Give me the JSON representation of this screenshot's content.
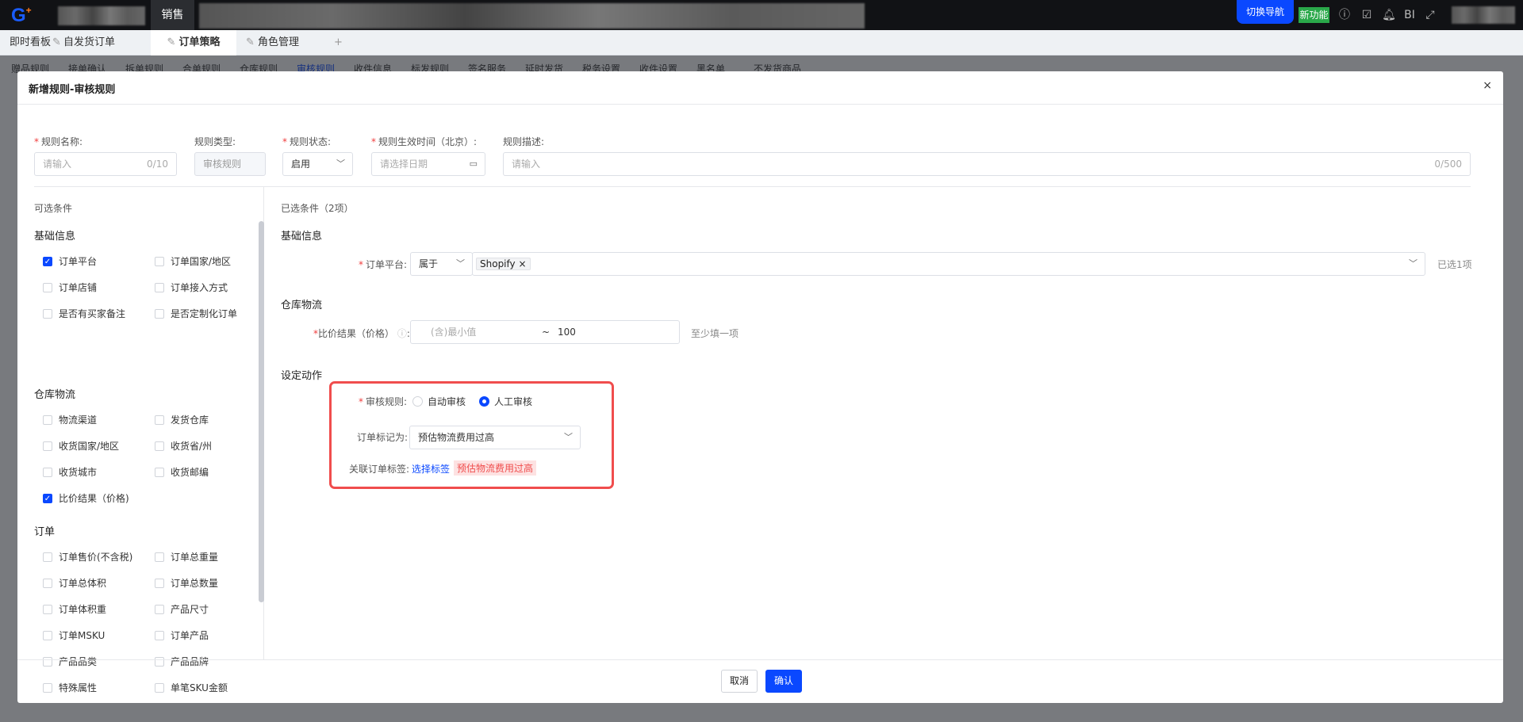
{
  "topbar": {
    "logo": "G",
    "active_module": "销售",
    "switch_nav": "切换导航",
    "new_feature": "新功能",
    "icons": [
      "info-icon",
      "calendar-check-icon",
      "bell-icon",
      "bi-icon",
      "fullscreen-icon"
    ],
    "bi_label": "BI"
  },
  "tabs": [
    {
      "label": "即时看板"
    },
    {
      "label": "自发货订单"
    },
    {
      "label": "订单策略",
      "active": true
    },
    {
      "label": "角色管理"
    }
  ],
  "tab_add": "+",
  "subnav": [
    "赠品规则",
    "接单确认",
    "拆单规则",
    "合单规则",
    "仓库规则",
    "审核规则",
    "收件信息",
    "标发规则",
    "签名服务",
    "延时发货",
    "税务设置",
    "收件设置",
    "黑名单",
    "不发货商品"
  ],
  "subnav_active_index": 5,
  "modal": {
    "title": "新增规则-审核规则",
    "close": "×",
    "form": {
      "name_label": "规则名称:",
      "name_placeholder": "请输入",
      "name_count": "0/10",
      "type_label": "规则类型:",
      "type_value": "审核规则",
      "status_label": "规则状态:",
      "status_value": "启用",
      "time_label": "规则生效时间（北京）:",
      "time_placeholder": "请选择日期",
      "desc_label": "规则描述:",
      "desc_placeholder": "请输入",
      "desc_count": "0/500"
    },
    "available": {
      "title": "可选条件",
      "groups": [
        {
          "name": "基础信息",
          "items": [
            {
              "label": "订单平台",
              "checked": true
            },
            {
              "label": "订单国家/地区",
              "checked": false
            },
            {
              "label": "订单店铺",
              "checked": false
            },
            {
              "label": "订单接入方式",
              "checked": false
            },
            {
              "label": "是否有买家备注",
              "checked": false
            },
            {
              "label": "是否定制化订单",
              "checked": false
            }
          ]
        },
        {
          "name": "仓库物流",
          "items": [
            {
              "label": "物流渠道",
              "checked": false
            },
            {
              "label": "发货仓库",
              "checked": false
            },
            {
              "label": "收货国家/地区",
              "checked": false
            },
            {
              "label": "收货省/州",
              "checked": false
            },
            {
              "label": "收货城市",
              "checked": false
            },
            {
              "label": "收货邮编",
              "checked": false
            },
            {
              "label": "比价结果（价格)",
              "checked": true
            }
          ]
        },
        {
          "name": "订单",
          "items": [
            {
              "label": "订单售价(不含税)",
              "checked": false
            },
            {
              "label": "订单总重量",
              "checked": false
            },
            {
              "label": "订单总体积",
              "checked": false
            },
            {
              "label": "订单总数量",
              "checked": false
            },
            {
              "label": "订单体积重",
              "checked": false
            },
            {
              "label": "产品尺寸",
              "checked": false
            },
            {
              "label": "订单MSKU",
              "checked": false
            },
            {
              "label": "订单产品",
              "checked": false
            },
            {
              "label": "产品品类",
              "checked": false
            },
            {
              "label": "产品品牌",
              "checked": false
            },
            {
              "label": "特殊属性",
              "checked": false
            },
            {
              "label": "单笔SKU金额",
              "checked": false
            }
          ]
        }
      ]
    },
    "selected": {
      "title": "已选条件（2项）",
      "basic_title": "基础信息",
      "platform_label": "订单平台:",
      "platform_op": "属于",
      "platform_tag": "Shopify",
      "platform_count": "已选1项",
      "logistics_title": "仓库物流",
      "price_label": "比价结果（价格）",
      "price_min_placeholder": "(含)最小值",
      "price_sep": "~",
      "price_max": "100",
      "price_hint": "至少填一项"
    },
    "action": {
      "title": "设定动作",
      "rule_label": "审核规则:",
      "options": [
        "自动审核",
        "人工审核"
      ],
      "selected_option": 1,
      "mark_label": "订单标记为:",
      "mark_value": "预估物流费用过高",
      "tag_label": "关联订单标签:",
      "tag_link": "选择标签",
      "tag_value": "预估物流费用过高"
    },
    "footer": {
      "cancel": "取消",
      "confirm": "确认"
    }
  }
}
